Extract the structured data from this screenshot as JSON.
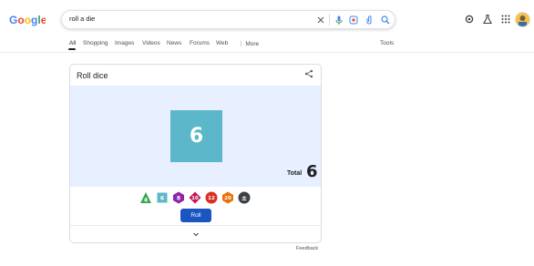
{
  "search": {
    "query": "roll a die"
  },
  "tabs": [
    {
      "label": "All"
    },
    {
      "label": "Shopping"
    },
    {
      "label": "Images"
    },
    {
      "label": "Videos"
    },
    {
      "label": "News"
    },
    {
      "label": "Forums"
    },
    {
      "label": "Web"
    },
    {
      "label": "More"
    }
  ],
  "tools_label": "Tools",
  "card": {
    "title": "Roll dice",
    "die_value": "6",
    "total_label": "Total",
    "total_value": "6",
    "dice_options": [
      "4",
      "6",
      "8",
      "10",
      "12",
      "20",
      "±"
    ],
    "roll_label": "Roll"
  },
  "feedback_label": "Feedback",
  "colors": {
    "die": "#5bb7c9",
    "roll_button": "#1a55c2",
    "stage_bg": "#e8efff",
    "d4": "#34a853",
    "d6": "#5bb7c9",
    "d8": "#8e24aa",
    "d10": "#c2185b",
    "d12": "#d93025",
    "d20": "#e8710a",
    "modifier": "#3c4043"
  }
}
